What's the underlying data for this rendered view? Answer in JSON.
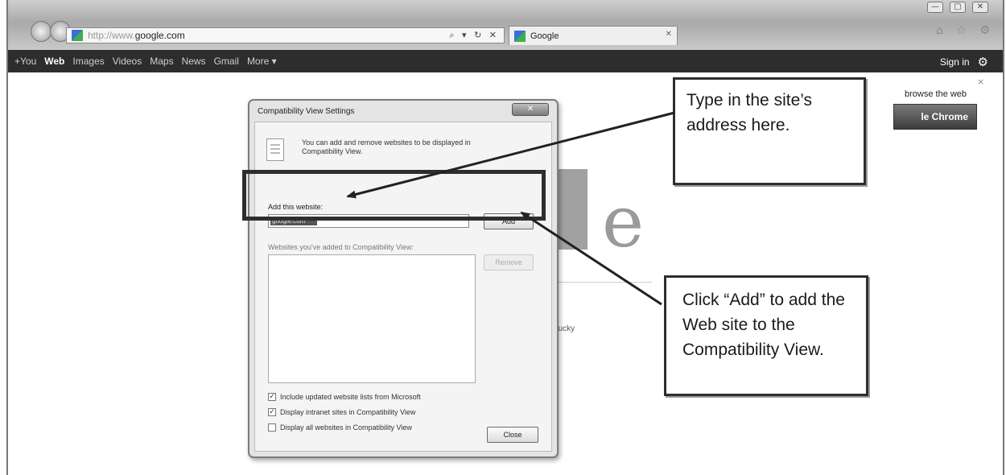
{
  "browser": {
    "url_prefix": "http://www.",
    "url_domain": "google.com",
    "addr_icons": "⌕ ▾ ↻ ✕",
    "tab_title": "Google",
    "window_controls": [
      "—",
      "▢",
      "✕"
    ],
    "tool_icons": "⌂ ☆ ⚙"
  },
  "google_bar": {
    "items": [
      "+You",
      "Web",
      "Images",
      "Videos",
      "Maps",
      "News",
      "Gmail",
      "More ▾"
    ],
    "sign_in": "Sign in",
    "gear_icon": "⚙"
  },
  "page": {
    "promo_text": "browse the web",
    "promo_close": "×",
    "chrome_button": "le Chrome",
    "lucky_text": "Lucky",
    "logo_letter": "e"
  },
  "dialog": {
    "title": "Compatibility View Settings",
    "close_x": "✕",
    "description": "You can add and remove websites to be displayed in Compatibility View.",
    "add_label": "Add this website:",
    "add_input_value": "google.com",
    "add_button": "Add",
    "list_label": "Websites you've added to Compatibility View:",
    "remove_button": "Remove",
    "checkboxes": [
      {
        "label": "Include updated website lists from Microsoft",
        "checked": "✓"
      },
      {
        "label": "Display intranet sites in Compatibility View",
        "checked": "✓"
      },
      {
        "label": "Display all websites in Compatibility View",
        "checked": ""
      }
    ],
    "close_button": "Close"
  },
  "callouts": {
    "top_text": "Type in the site’s address here.",
    "bottom_text": "Click “Add” to add the Web site to the Compatibility View."
  }
}
